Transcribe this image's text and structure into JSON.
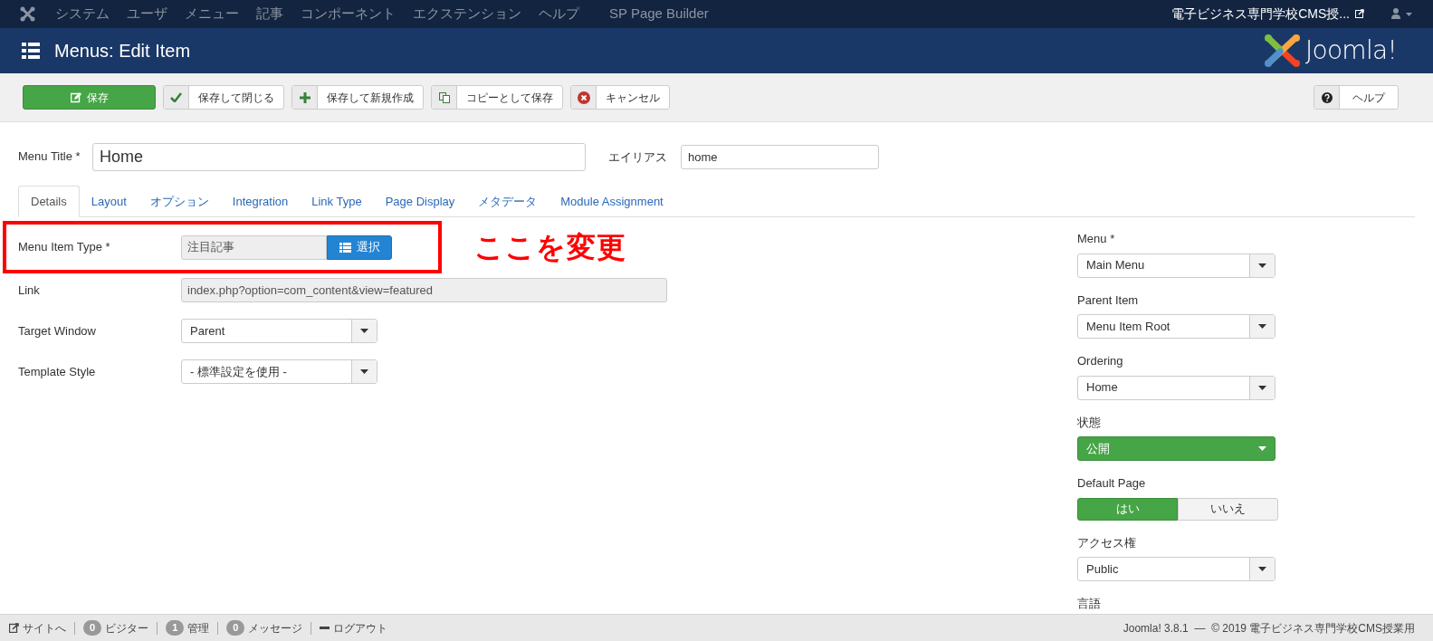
{
  "top_nav": {
    "menu": [
      "システム",
      "ユーザ",
      "メニュー",
      "記事",
      "コンポーネント",
      "エクステンション",
      "ヘルプ",
      "SP Page Builder"
    ],
    "site_link": "電子ビジネス専門学校CMS授..."
  },
  "header": {
    "title": "Menus: Edit Item",
    "logo_text": "Joomla!"
  },
  "toolbar": {
    "buttons": [
      {
        "label": "保存",
        "kind": "save",
        "primary": true
      },
      {
        "label": "保存して閉じる",
        "kind": "check",
        "primary": false
      },
      {
        "label": "保存して新規作成",
        "kind": "plus",
        "primary": false
      },
      {
        "label": "コピーとして保存",
        "kind": "copy",
        "primary": false
      },
      {
        "label": "キャンセル",
        "kind": "cancel",
        "primary": false
      }
    ],
    "help": "ヘルプ"
  },
  "title_row": {
    "menu_title": {
      "label": "Menu Title *",
      "value": "Home"
    },
    "alias": {
      "label": "エイリアス",
      "value": "home"
    }
  },
  "tabs": [
    {
      "label": "Details",
      "selected": true
    },
    {
      "label": "Layout",
      "selected": false
    },
    {
      "label": "オプション",
      "selected": false
    },
    {
      "label": "Integration",
      "selected": false
    },
    {
      "label": "Link Type",
      "selected": false
    },
    {
      "label": "Page Display",
      "selected": false
    },
    {
      "label": "メタデータ",
      "selected": false
    },
    {
      "label": "Module Assignment",
      "selected": false
    }
  ],
  "fields": [
    {
      "kind": "type_select",
      "label": "Menu Item Type *",
      "value": "注目記事",
      "button": "選択",
      "highlighted": true
    },
    {
      "kind": "readonly",
      "label": "Link",
      "value": "index.php?option=com_content&view=featured"
    },
    {
      "kind": "select",
      "label": "Target Window",
      "value": "Parent"
    },
    {
      "kind": "select",
      "label": "Template Style",
      "value": "- 標準設定を使用 -"
    }
  ],
  "annotation": "ここを変更",
  "sidebar": [
    {
      "kind": "select",
      "label": "Menu *",
      "value": "Main Menu"
    },
    {
      "kind": "select",
      "label": "Parent Item",
      "value": "Menu Item Root"
    },
    {
      "kind": "select",
      "label": "Ordering",
      "value": "Home"
    },
    {
      "kind": "status",
      "label": "状態",
      "value": "公開"
    },
    {
      "kind": "toggle",
      "label": "Default Page",
      "options": [
        {
          "label": "はい",
          "selected": true
        },
        {
          "label": "いいえ",
          "selected": false
        }
      ]
    },
    {
      "kind": "select",
      "label": "アクセス権",
      "value": "Public"
    },
    {
      "kind": "label",
      "label": "言語"
    }
  ],
  "status_bar": {
    "items": [
      {
        "kind": "link",
        "label": "サイトへ"
      },
      {
        "kind": "count",
        "count": "0",
        "label": "ビジター"
      },
      {
        "kind": "count",
        "count": "1",
        "label": "管理"
      },
      {
        "kind": "count",
        "count": "0",
        "label": "メッセージ"
      },
      {
        "kind": "logout",
        "label": "ログアウト"
      }
    ],
    "copyright": "Joomla! 3.8.1  —  © 2019 電子ビジネス専門学校CMS授業用"
  }
}
